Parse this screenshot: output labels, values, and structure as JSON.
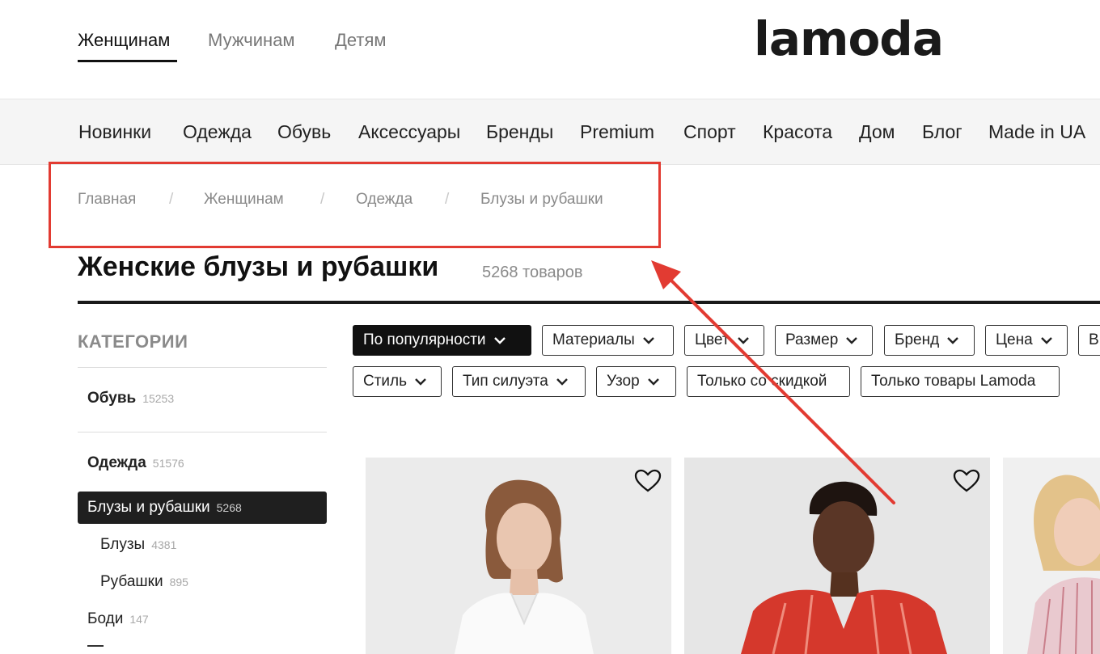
{
  "header": {
    "gender_tabs": [
      "Женщинам",
      "Мужчинам",
      "Детям"
    ],
    "logo": "lamoda"
  },
  "nav": {
    "items": [
      "Новинки",
      "Одежда",
      "Обувь",
      "Аксессуары",
      "Бренды",
      "Premium",
      "Спорт",
      "Красота",
      "Дом",
      "Блог",
      "Made in UA"
    ]
  },
  "breadcrumb": {
    "items": [
      "Главная",
      "Женщинам",
      "Одежда",
      "Блузы и рубашки"
    ],
    "separator": "/"
  },
  "page": {
    "title": "Женские блузы и рубашки",
    "count": "5268 товаров"
  },
  "sidebar": {
    "heading": "КАТЕГОРИИ",
    "items": [
      {
        "label": "Обувь",
        "count": "15253"
      },
      {
        "label": "Одежда",
        "count": "51576"
      },
      {
        "label": "Блузы и рубашки",
        "count": "5268"
      },
      {
        "label": "Блузы",
        "count": "4381"
      },
      {
        "label": "Рубашки",
        "count": "895"
      },
      {
        "label": "Боди",
        "count": "147"
      }
    ]
  },
  "filters": {
    "row1": [
      "По популярности",
      "Материалы",
      "Цвет",
      "Размер",
      "Бренд",
      "Цена",
      "В"
    ],
    "row2": [
      "Стиль",
      "Тип силуэта",
      "Узор",
      "Только со скидкой",
      "Только товары Lamoda"
    ]
  },
  "colors": {
    "annotation_red": "#e23b32",
    "dark": "#111111",
    "nav_bg": "#f5f5f5"
  }
}
